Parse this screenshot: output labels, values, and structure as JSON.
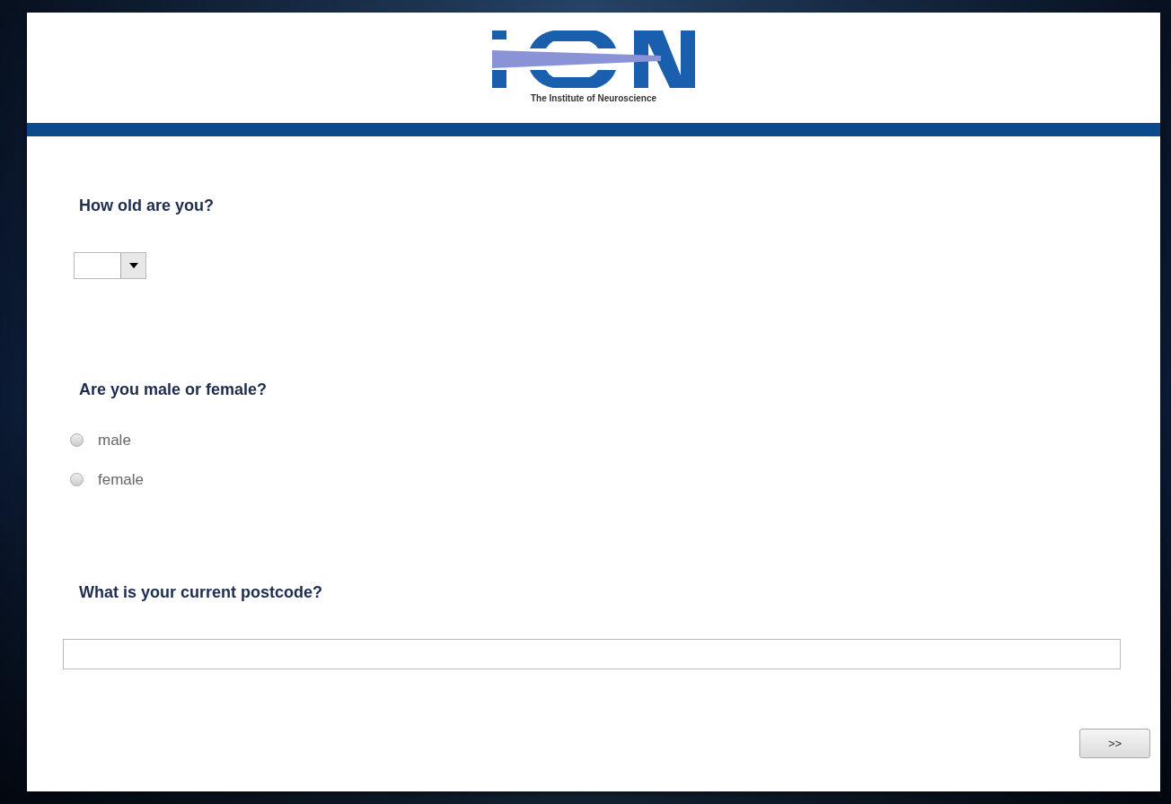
{
  "header": {
    "logo_caption": "The Institute of Neuroscience"
  },
  "questions": [
    {
      "kind": "dropdown",
      "label": "How old are you?"
    },
    {
      "kind": "radio",
      "label": "Are you male or female?",
      "options": [
        {
          "label": "male",
          "selected": false
        },
        {
          "label": "female",
          "selected": false
        }
      ]
    },
    {
      "kind": "text",
      "label": "What is your current postcode?"
    }
  ],
  "next_button": ">>"
}
